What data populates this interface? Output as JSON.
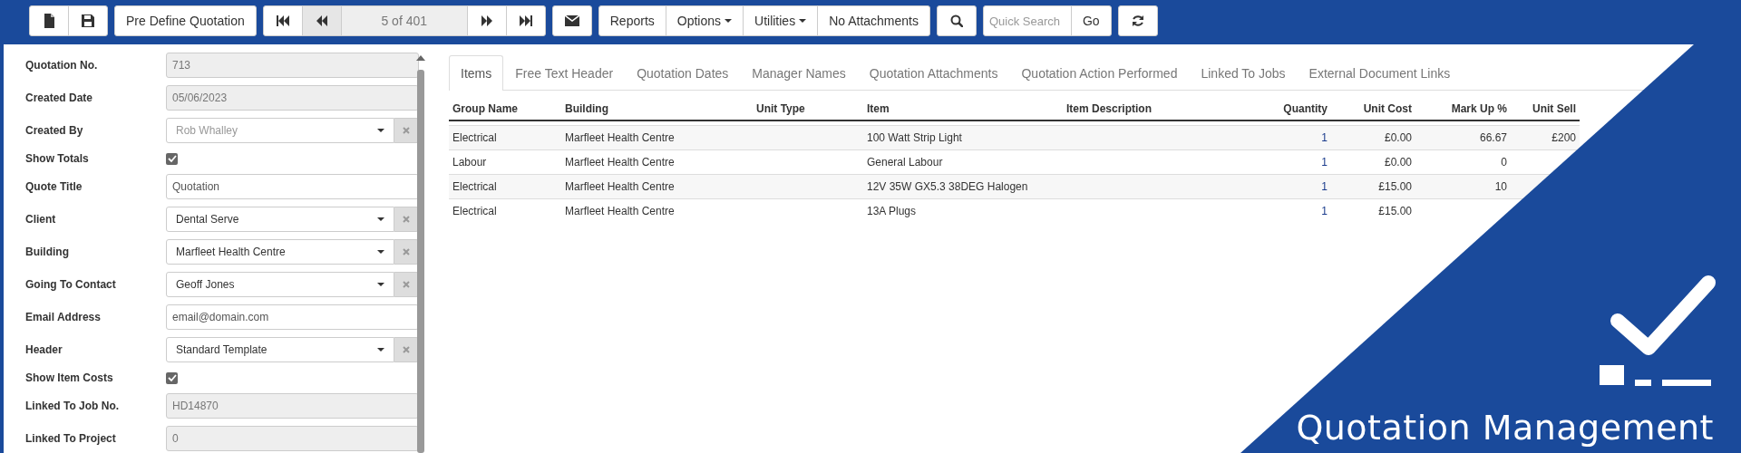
{
  "toolbar": {
    "groups": [
      [
        {
          "kind": "new"
        },
        {
          "kind": "save"
        }
      ],
      [
        {
          "kind": "text",
          "label": "Pre Define Quotation"
        }
      ],
      [
        {
          "kind": "first",
          "disabled": false
        },
        {
          "kind": "prev",
          "disabled": true
        },
        {
          "kind": "pager",
          "label": "5 of 401"
        },
        {
          "kind": "next",
          "disabled": false
        },
        {
          "kind": "last",
          "disabled": false
        }
      ],
      [
        {
          "kind": "mail"
        }
      ],
      [
        {
          "kind": "text",
          "label": "Reports"
        },
        {
          "kind": "dropdown",
          "label": "Options"
        },
        {
          "kind": "dropdown",
          "label": "Utilities"
        },
        {
          "kind": "text",
          "label": "No Attachments"
        }
      ],
      [
        {
          "kind": "search"
        }
      ],
      [
        {
          "kind": "field",
          "placeholder": "Quick Search"
        },
        {
          "kind": "text",
          "label": "Go"
        }
      ],
      [
        {
          "kind": "refresh"
        }
      ]
    ]
  },
  "form": {
    "fields": [
      {
        "kind": "readonly",
        "label": "Quotation No.",
        "value": "713"
      },
      {
        "kind": "readonly",
        "label": "Created Date",
        "value": "05/06/2023"
      },
      {
        "kind": "select",
        "label": "Created By",
        "value": "Rob Whalley",
        "disabled": true
      },
      {
        "kind": "checkbox",
        "label": "Show Totals",
        "checked": true
      },
      {
        "kind": "text",
        "label": "Quote Title",
        "value": "Quotation"
      },
      {
        "kind": "select",
        "label": "Client",
        "value": "Dental Serve",
        "disabled": false
      },
      {
        "kind": "select",
        "label": "Building",
        "value": "Marfleet Health Centre",
        "disabled": false
      },
      {
        "kind": "select",
        "label": "Going To Contact",
        "value": "Geoff Jones",
        "disabled": false
      },
      {
        "kind": "text",
        "label": "Email Address",
        "value": "email@domain.com"
      },
      {
        "kind": "select",
        "label": "Header",
        "value": "Standard Template",
        "disabled": false
      },
      {
        "kind": "checkbox",
        "label": "Show Item Costs",
        "checked": true
      },
      {
        "kind": "readonly",
        "label": "Linked To Job No.",
        "value": "HD14870"
      },
      {
        "kind": "readonly",
        "label": "Linked To Project",
        "value": "0"
      }
    ]
  },
  "tabs": [
    {
      "label": "Items",
      "selected": true
    },
    {
      "label": "Free Text Header",
      "selected": false
    },
    {
      "label": "Quotation Dates",
      "selected": false
    },
    {
      "label": "Manager Names",
      "selected": false
    },
    {
      "label": "Quotation Attachments",
      "selected": false
    },
    {
      "label": "Quotation Action Performed",
      "selected": false
    },
    {
      "label": "Linked To Jobs",
      "selected": false
    },
    {
      "label": "External Document Links",
      "selected": false
    }
  ],
  "table": {
    "columns": [
      {
        "label": "Group Name",
        "kind": "text"
      },
      {
        "label": "Building",
        "kind": "text"
      },
      {
        "label": "Unit Type",
        "kind": "text"
      },
      {
        "label": "Item",
        "kind": "text"
      },
      {
        "label": "Item Description",
        "kind": "text"
      },
      {
        "label": "Quantity",
        "kind": "count"
      },
      {
        "label": "Unit Cost",
        "kind": "number"
      },
      {
        "label": "Mark Up %",
        "kind": "number"
      },
      {
        "label": "Unit Sell",
        "kind": "number"
      }
    ],
    "rows": [
      {
        "cells": [
          "Electrical",
          "Marfleet Health Centre",
          null,
          "100 Watt Strip Light",
          null,
          "1",
          "£0.00",
          "66.67",
          "£200"
        ]
      },
      {
        "cells": [
          "Labour",
          "Marfleet Health Centre",
          null,
          "General Labour",
          null,
          "1",
          "£0.00",
          "0",
          null
        ]
      },
      {
        "cells": [
          "Electrical",
          "Marfleet Health Centre",
          null,
          "12V 35W GX5.3 38DEG Halogen",
          null,
          "1",
          "£15.00",
          "10",
          null
        ]
      },
      {
        "cells": [
          "Electrical",
          "Marfleet Health Centre",
          null,
          "13A Plugs",
          null,
          "1",
          "£15.00",
          null,
          null
        ]
      }
    ]
  },
  "banner": {
    "title": "Quotation Management"
  }
}
